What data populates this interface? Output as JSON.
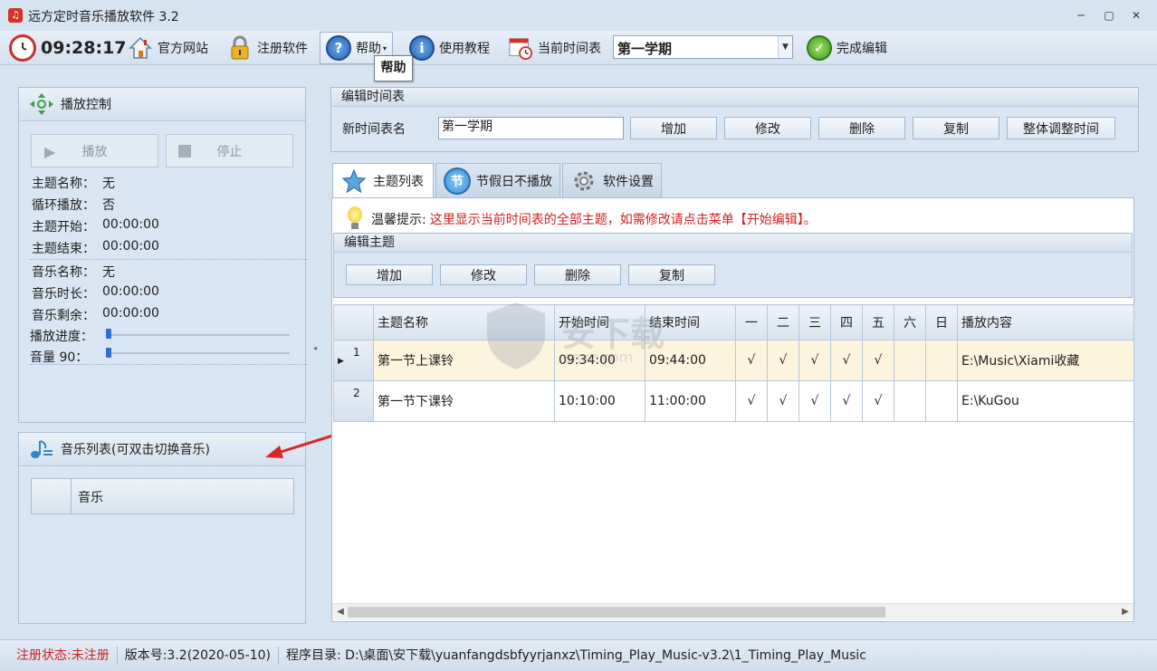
{
  "window": {
    "title": "远方定时音乐播放软件 3.2"
  },
  "toolbar": {
    "clock": "09:28:17",
    "website_label": "官方网站",
    "register_label": "注册软件",
    "help_label": "帮助",
    "tutorial_label": "使用教程",
    "current_schedule_label": "当前时间表",
    "current_schedule_value": "第一学期",
    "finish_edit_label": "完成编辑"
  },
  "tooltip": {
    "text": "帮助"
  },
  "playback": {
    "title": "播放控制",
    "play_label": "播放",
    "stop_label": "停止",
    "rows": [
      {
        "label": "主题名称：",
        "value": "无"
      },
      {
        "label": "循环播放：",
        "value": "否"
      },
      {
        "label": "主题开始：",
        "value": "00:00:00"
      },
      {
        "label": "主题结束：",
        "value": "00:00:00"
      },
      {
        "label": "音乐名称：",
        "value": "无"
      },
      {
        "label": "音乐时长：",
        "value": "00:00:00"
      },
      {
        "label": "音乐剩余：",
        "value": "00:00:00"
      }
    ],
    "progress_label": "播放进度：",
    "progress": 0,
    "volume_label": "音量 90：",
    "volume": 90
  },
  "music_list": {
    "title": "音乐列表(可双击切换音乐)",
    "column": "音乐"
  },
  "edit_schedule": {
    "title": "编辑时间表",
    "name_label": "新时间表名",
    "name_value": "第一学期",
    "buttons": [
      "增加",
      "修改",
      "删除",
      "复制",
      "整体调整时间"
    ]
  },
  "tabs": [
    {
      "label": "主题列表",
      "icon": "star-icon"
    },
    {
      "label": "节假日不播放",
      "icon": "holiday-icon"
    },
    {
      "label": "软件设置",
      "icon": "gear-icon"
    }
  ],
  "tip": {
    "prefix": "温馨提示:",
    "text": "这里显示当前时间表的全部主题，如需修改请点击菜单【开始编辑】。"
  },
  "edit_theme": {
    "title": "编辑主题",
    "buttons": [
      "增加",
      "修改",
      "删除",
      "复制"
    ]
  },
  "table": {
    "headers": [
      "主题名称",
      "开始时间",
      "结束时间",
      "一",
      "二",
      "三",
      "四",
      "五",
      "六",
      "日",
      "播放内容"
    ],
    "rows": [
      {
        "index": "1",
        "name": "第一节上课铃",
        "start": "09:34:00",
        "end": "09:44:00",
        "days": [
          "√",
          "√",
          "√",
          "√",
          "√",
          "",
          ""
        ],
        "content": "E:\\Music\\Xiami收藏"
      },
      {
        "index": "2",
        "name": "第一节下课铃",
        "start": "10:10:00",
        "end": "11:00:00",
        "days": [
          "√",
          "√",
          "√",
          "√",
          "√",
          "",
          ""
        ],
        "content": "E:\\KuGou"
      }
    ]
  },
  "statusbar": {
    "register_status": "注册状态:未注册",
    "version": "版本号:3.2(2020-05-10)",
    "program_dir": "程序目录: D:\\桌面\\安下载\\yuanfangdsbfyyrjanxz\\Timing_Play_Music-v3.2\\1_Timing_Play_Music"
  },
  "watermark": {
    "text": "安下载",
    "sub": "anxz.com"
  },
  "colors": {
    "accent": "#3f8fd2",
    "status_red": "#d42020",
    "selected_row": "#fdf4dd",
    "arrow": "#d8262b"
  }
}
